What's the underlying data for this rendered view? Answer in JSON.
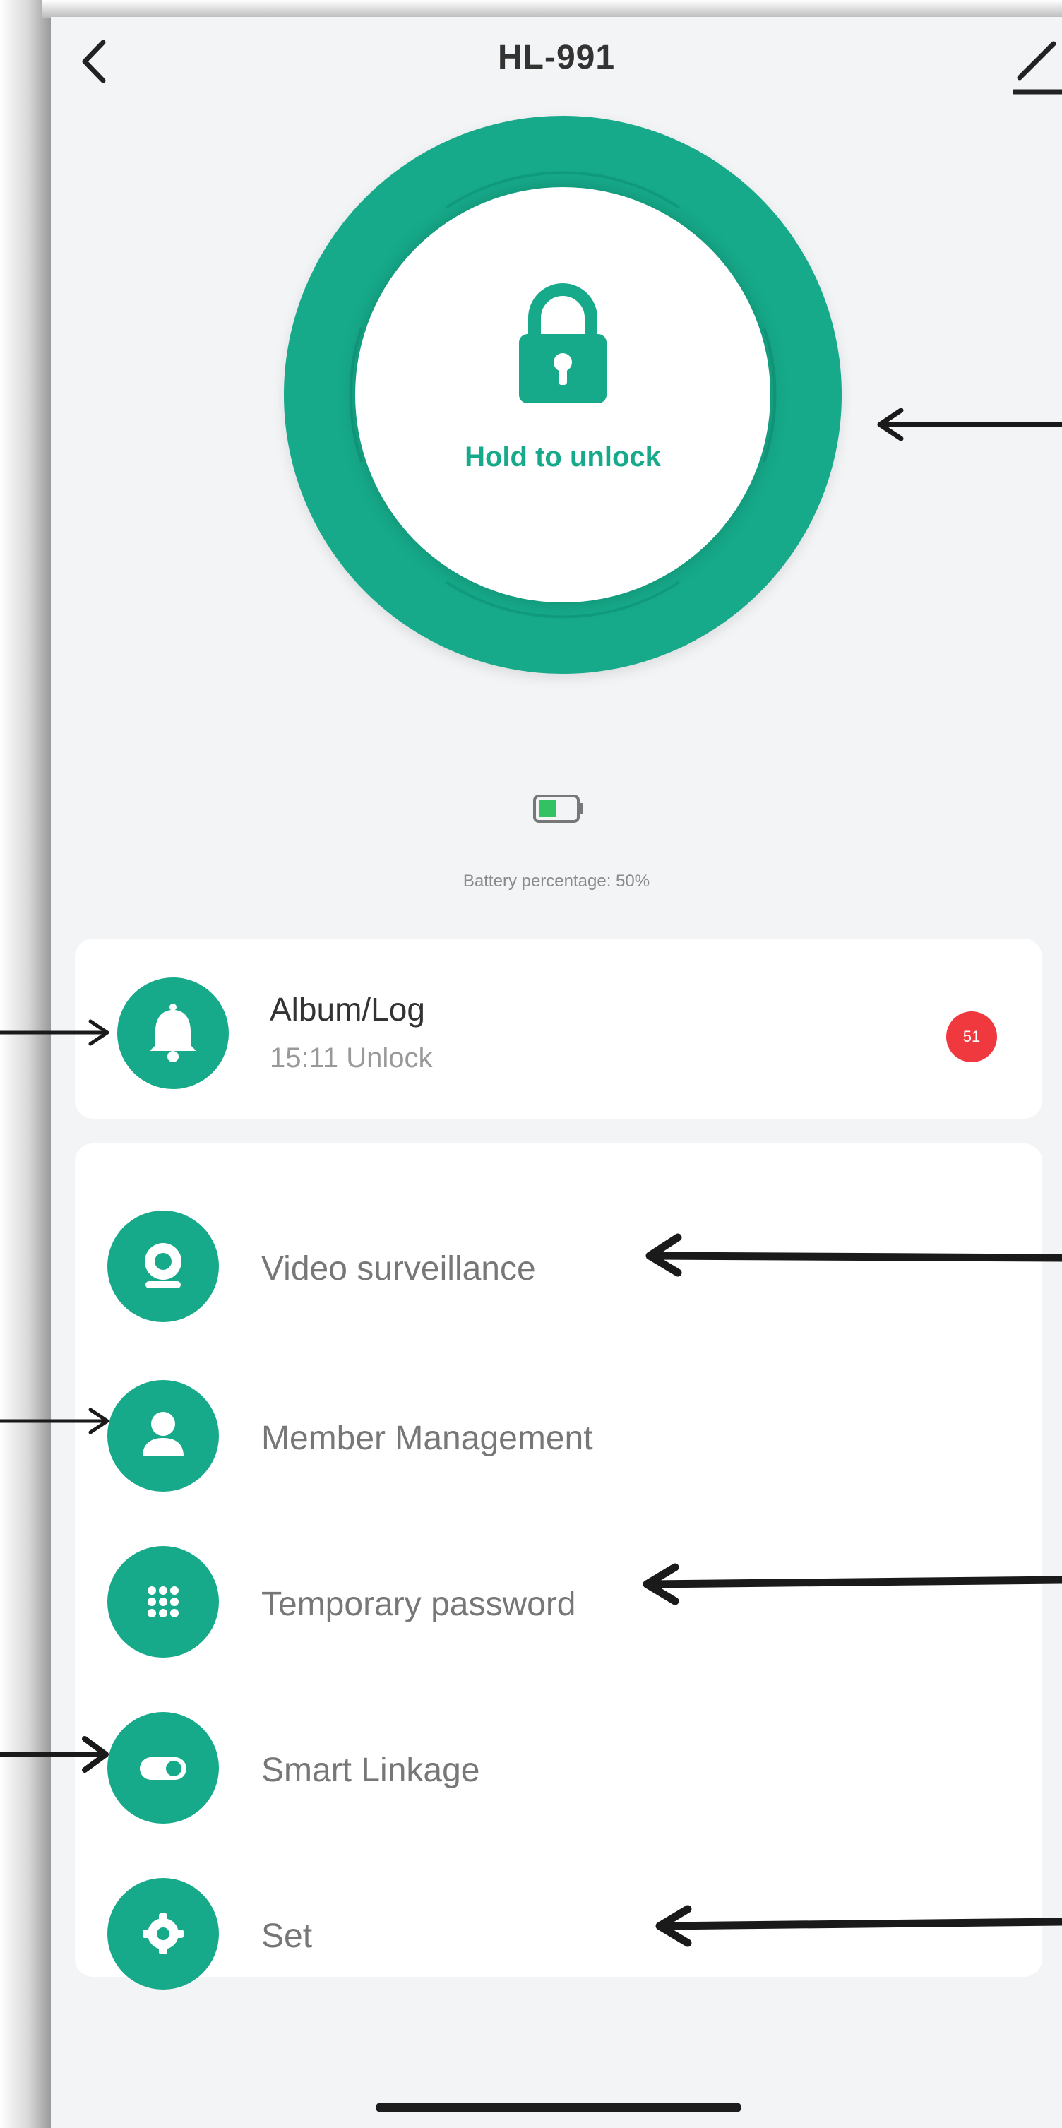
{
  "header": {
    "title": "HL-991",
    "back_icon": "chevron-left-icon",
    "edit_icon": "pencil-edit-icon"
  },
  "unlock": {
    "label": "Hold to unlock",
    "icon": "padlock-icon"
  },
  "battery": {
    "icon": "battery-icon",
    "text": "Battery percentage: 50%",
    "level_percent": 50
  },
  "log_card": {
    "icon": "bell-icon",
    "title": "Album/Log",
    "subtitle": "15:11  Unlock",
    "badge": "51"
  },
  "menu": {
    "items": [
      {
        "label": "Video surveillance",
        "icon": "camera-icon"
      },
      {
        "label": "Member Management",
        "icon": "person-icon"
      },
      {
        "label": "Temporary password",
        "icon": "keypad-icon"
      },
      {
        "label": "Smart Linkage",
        "icon": "toggle-icon"
      },
      {
        "label": "Set",
        "icon": "gear-icon"
      }
    ]
  },
  "colors": {
    "accent": "#16aa8a",
    "background": "#f3f4f6",
    "card": "#ffffff",
    "badge": "#f0383f",
    "annotation_arrow": "#1a1a1a"
  }
}
